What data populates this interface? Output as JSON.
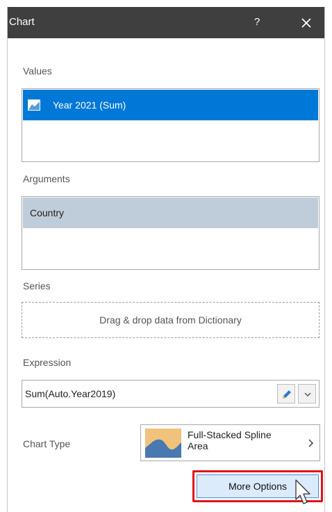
{
  "window": {
    "title": "Chart",
    "help_label": "?"
  },
  "values": {
    "label": "Values",
    "items": [
      {
        "label": "Year 2021 (Sum)",
        "icon": "area-chart-icon"
      }
    ]
  },
  "arguments": {
    "label": "Arguments",
    "items": [
      {
        "label": "Country"
      }
    ]
  },
  "series": {
    "label": "Series",
    "placeholder": "Drag & drop data from Dictionary"
  },
  "expression": {
    "label": "Expression",
    "value": "Sum(Auto.Year2019)"
  },
  "chart_type": {
    "label": "Chart Type",
    "value": "Full-Stacked Spline Area",
    "icon": "full-stacked-spline-area-icon"
  },
  "more_options": {
    "label": "More Options"
  },
  "colors": {
    "titlebar": "#3f3f3f",
    "selected": "#0078d7",
    "field": "#bfccd9",
    "highlight_border": "#e0121a",
    "button_bg": "#dcebfb"
  }
}
